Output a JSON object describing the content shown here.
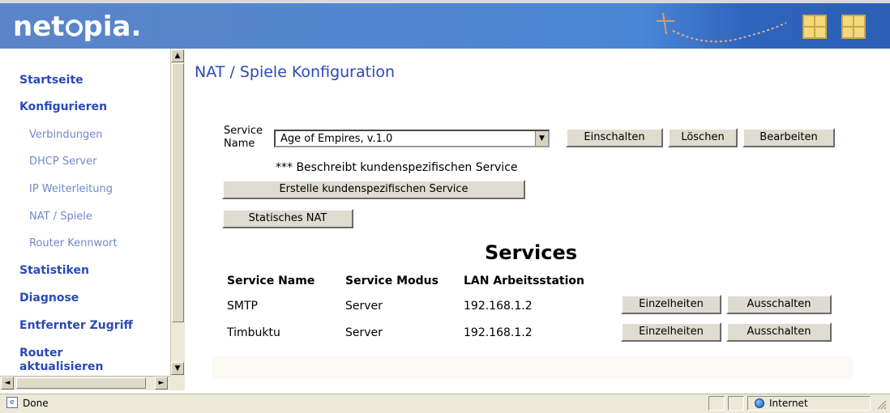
{
  "header": {
    "logo_text": "netopia.",
    "logo_prefix": "net",
    "logo_suffix": "pia.",
    "accent_color": "#4f86d2",
    "icons": [
      "star-icon",
      "window-icon",
      "window-icon"
    ]
  },
  "sidebar": {
    "items": [
      {
        "label": "Startseite",
        "level": "top"
      },
      {
        "label": "Konfigurieren",
        "level": "top"
      },
      {
        "label": "Verbindungen",
        "level": "sub"
      },
      {
        "label": "DHCP Server",
        "level": "sub"
      },
      {
        "label": "IP Weiterleitung",
        "level": "sub"
      },
      {
        "label": "NAT / Spiele",
        "level": "sub"
      },
      {
        "label": "Router Kennwort",
        "level": "sub"
      },
      {
        "label": "Statistiken",
        "level": "top"
      },
      {
        "label": "Diagnose",
        "level": "top"
      },
      {
        "label": "Entfernter Zugriff",
        "level": "top"
      },
      {
        "label": "Router aktualisieren",
        "level": "top",
        "lines": [
          "Router",
          "aktualisieren"
        ]
      }
    ],
    "scroll_up": "▲",
    "scroll_down": "▼",
    "scroll_left": "◄",
    "scroll_right": "►"
  },
  "main": {
    "title": "NAT / Spiele Konfiguration",
    "service_label_line1": "Service",
    "service_label_line2": "Name",
    "service_select_value": "Age of Empires, v.1.0",
    "select_arrow": "▼",
    "buttons": {
      "enable": "Einschalten",
      "delete": "Löschen",
      "edit": "Bearbeiten",
      "create_custom": "Erstelle kundenspezifischen Service",
      "static_nat": "Statisches NAT"
    },
    "custom_note": "*** Beschreibt kundenspezifischen Service",
    "services_title": "Services",
    "table": {
      "headers": [
        "Service Name",
        "Service Modus",
        "LAN Arbeitsstation"
      ],
      "rows": [
        {
          "name": "SMTP",
          "mode": "Server",
          "station": "192.168.1.2",
          "details": "Einzelheiten",
          "disable": "Ausschalten"
        },
        {
          "name": "Timbuktu",
          "mode": "Server",
          "station": "192.168.1.2",
          "details": "Einzelheiten",
          "disable": "Ausschalten"
        }
      ]
    }
  },
  "statusbar": {
    "status": "Done",
    "zone": "Internet"
  }
}
